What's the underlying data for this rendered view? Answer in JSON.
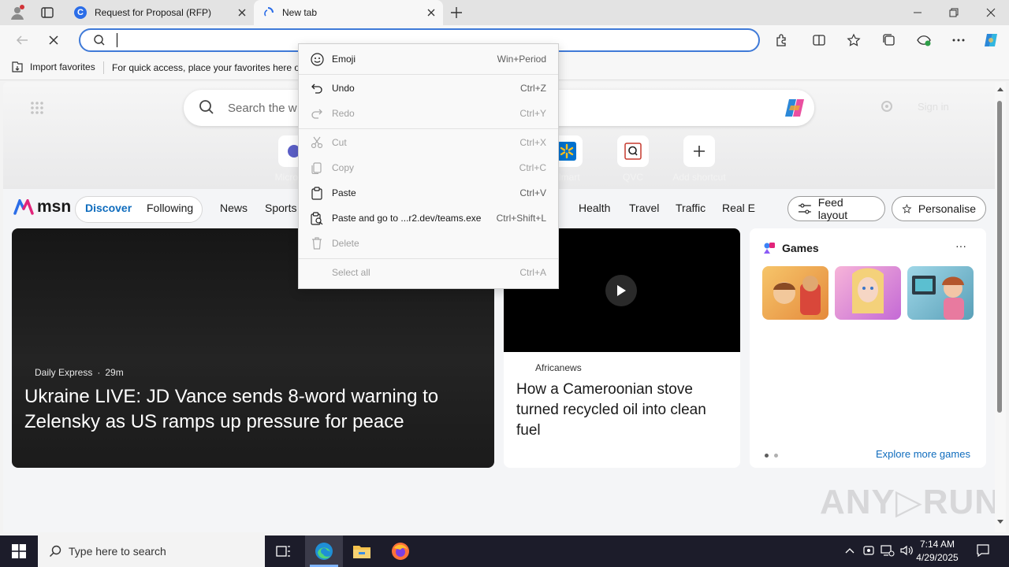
{
  "browser": {
    "tabs": [
      {
        "title": "Request for Proposal (RFP)",
        "icon": "c-logo-icon"
      },
      {
        "title": "New tab",
        "icon": "edge-loading-icon"
      }
    ],
    "address": {
      "value": "",
      "placeholder": ""
    },
    "favorites_bar": {
      "import_label": "Import favorites",
      "hint": "For quick access, place your favorites here on"
    }
  },
  "newtab": {
    "search_placeholder": "Search the w",
    "signin": "Sign in",
    "shortcuts": [
      {
        "label": "Microsoft",
        "icon": "microsoft-icon"
      },
      {
        "label": "almart",
        "icon": "walmart-icon"
      },
      {
        "label": "QVC",
        "icon": "qvc-icon"
      },
      {
        "label": "Add shortcut",
        "icon": "plus-icon"
      }
    ],
    "brand": "msn",
    "feed_tabs": [
      "Discover",
      "Following"
    ],
    "nav_links": [
      "News",
      "Sports",
      "Health",
      "Travel",
      "Traffic",
      "Real E"
    ],
    "feed_layout": "Feed layout",
    "personalise": "Personalise",
    "main_story": {
      "source": "Daily Express",
      "age": "29m",
      "headline": "Ukraine LIVE: JD Vance sends 8-word warning to Zelensky as US ramps up pressure for peace"
    },
    "video_story": {
      "source": "Africanews",
      "headline": "How a Cameroonian stove turned recycled oil into clean fuel"
    },
    "games": {
      "title": "Games",
      "more": "···",
      "link": "Explore more games"
    },
    "watermark": "ANY▷RUN"
  },
  "context_menu": {
    "items": [
      {
        "label": "Emoji",
        "shortcut": "Win+Period",
        "icon": "emoji-icon",
        "enabled": true
      },
      {
        "label": "Undo",
        "shortcut": "Ctrl+Z",
        "icon": "undo-icon",
        "enabled": true
      },
      {
        "label": "Redo",
        "shortcut": "Ctrl+Y",
        "icon": "redo-icon",
        "enabled": false
      },
      {
        "label": "Cut",
        "shortcut": "Ctrl+X",
        "icon": "cut-icon",
        "enabled": false
      },
      {
        "label": "Copy",
        "shortcut": "Ctrl+C",
        "icon": "copy-icon",
        "enabled": false
      },
      {
        "label": "Paste",
        "shortcut": "Ctrl+V",
        "icon": "paste-icon",
        "enabled": true
      },
      {
        "label": "Paste and go to ...r2.dev/teams.exe",
        "shortcut": "Ctrl+Shift+L",
        "icon": "paste-go-icon",
        "enabled": true
      },
      {
        "label": "Delete",
        "shortcut": "",
        "icon": "delete-icon",
        "enabled": false
      },
      {
        "label": "Select all",
        "shortcut": "Ctrl+A",
        "icon": "",
        "enabled": false
      }
    ]
  },
  "taskbar": {
    "search_placeholder": "Type here to search",
    "time": "7:14 AM",
    "date": "4/29/2025"
  },
  "colors": {
    "accent": "#0f6cbd",
    "address_border": "#3f7ad8",
    "taskbar": "#1c1c2a"
  }
}
